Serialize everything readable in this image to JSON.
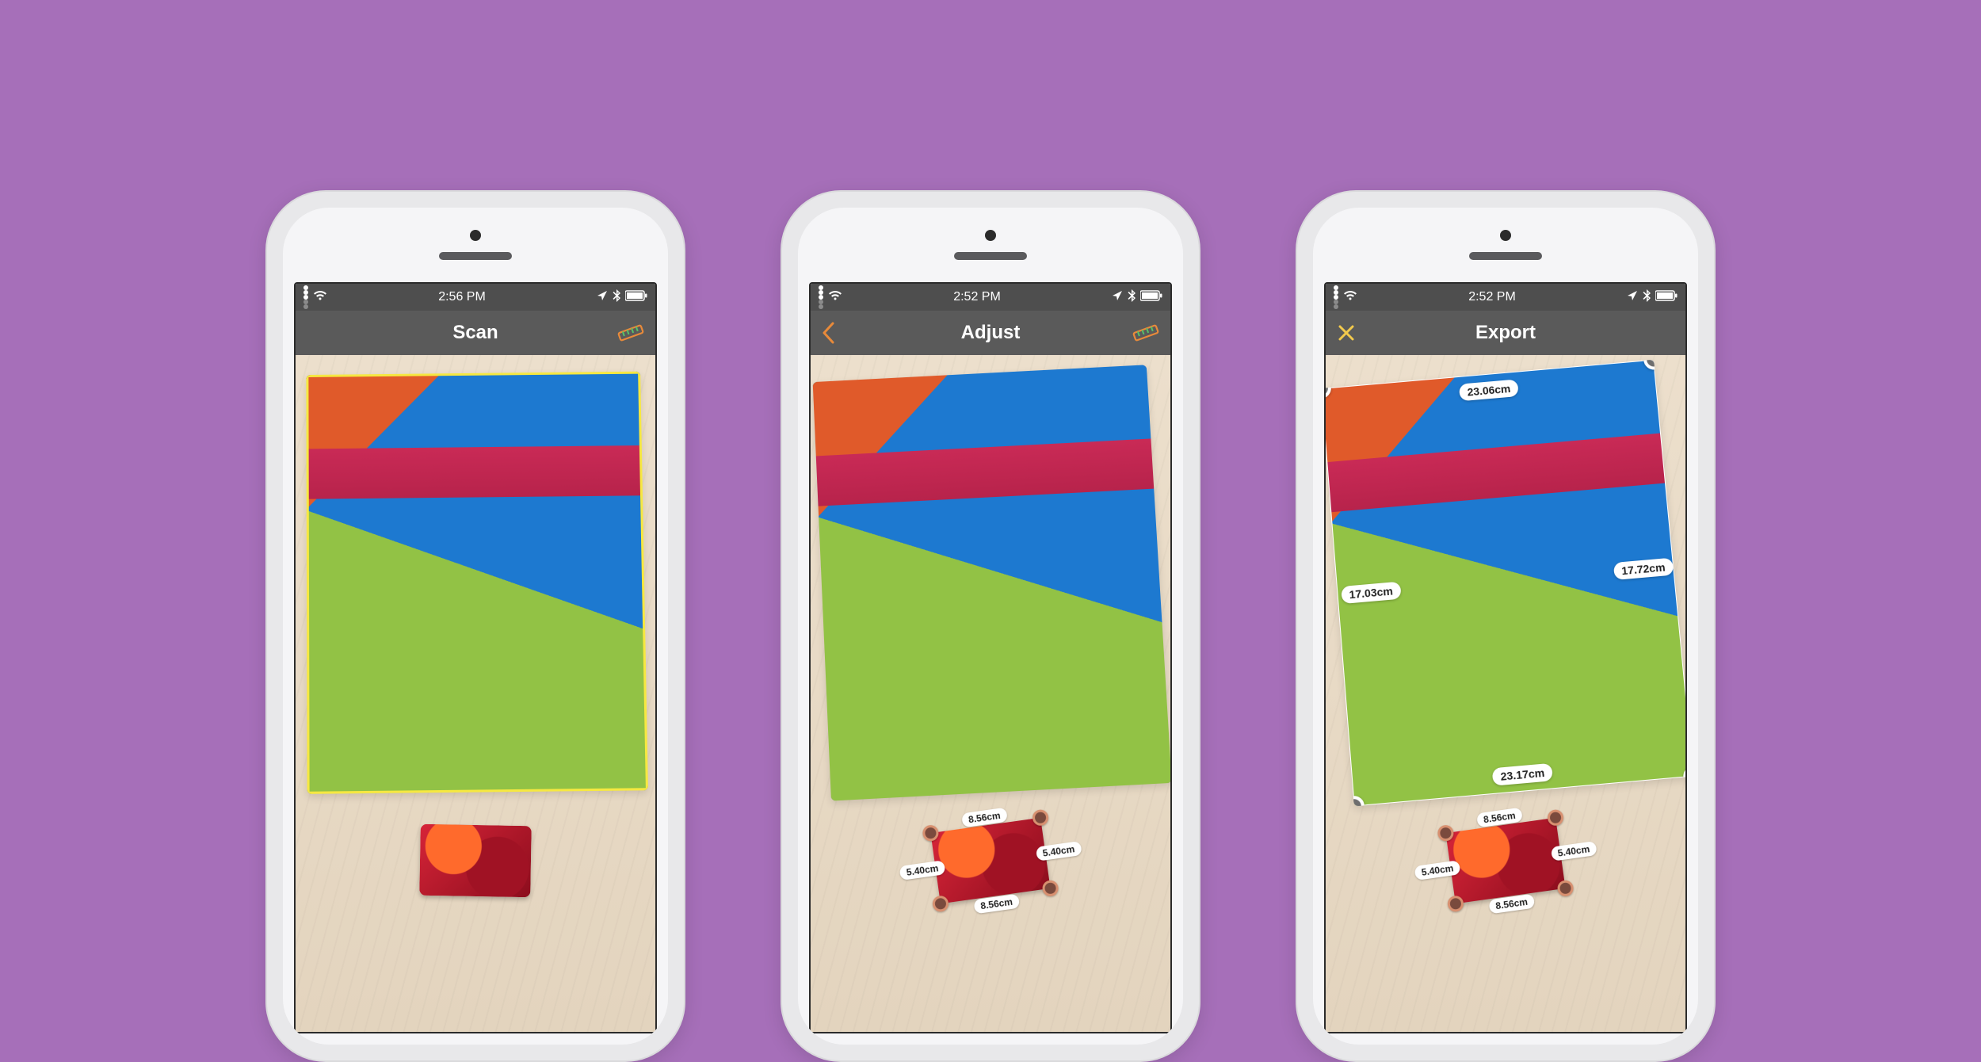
{
  "colors": {
    "background": "#a66fb9",
    "nav_bg": "#5a5a5a",
    "status_bg": "#4e4e4e",
    "accent_orange": "#e88a3a",
    "accent_green": "#56c268",
    "accent_yellow": "#f2c94c"
  },
  "phones": [
    {
      "status": {
        "time": "2:56 PM"
      },
      "nav": {
        "title": "Scan"
      }
    },
    {
      "status": {
        "time": "2:52 PM"
      },
      "nav": {
        "title": "Adjust"
      },
      "card_measure": {
        "top": "8.56cm",
        "right": "5.40cm",
        "bottom": "8.56cm",
        "left": "5.40cm"
      }
    },
    {
      "status": {
        "time": "2:52 PM"
      },
      "nav": {
        "title": "Export"
      },
      "fabric_measure": {
        "top": "23.06cm",
        "right": "17.72cm",
        "bottom": "23.17cm",
        "left": "17.03cm"
      },
      "card_measure": {
        "top": "8.56cm",
        "right": "5.40cm",
        "bottom": "8.56cm",
        "left": "5.40cm"
      }
    }
  ]
}
